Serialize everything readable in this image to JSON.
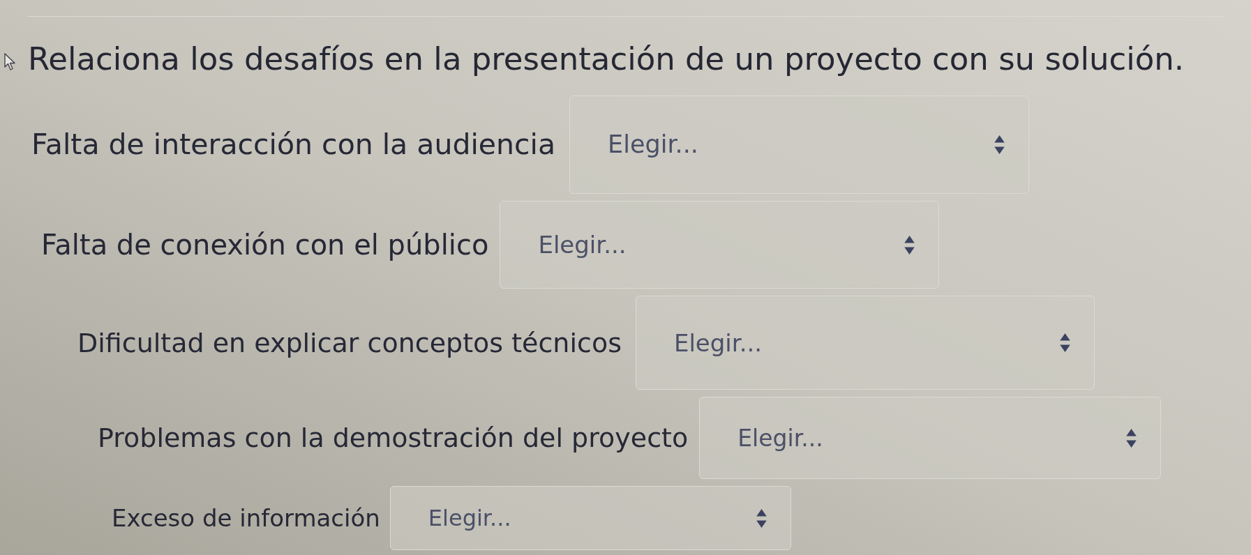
{
  "question": {
    "prompt": "Relaciona los desafíos en la presentación de un proyecto con su solución."
  },
  "pairs": [
    {
      "challenge": "Falta de interacción con la audiencia",
      "select": {
        "placeholder": "Elegir..."
      }
    },
    {
      "challenge": "Falta de conexión con el público",
      "select": {
        "placeholder": "Elegir..."
      }
    },
    {
      "challenge": "Dificultad en explicar conceptos técnicos",
      "select": {
        "placeholder": "Elegir..."
      }
    },
    {
      "challenge": "Problemas con la demostración del proyecto",
      "select": {
        "placeholder": "Elegir..."
      }
    },
    {
      "challenge": "Exceso de información",
      "select": {
        "placeholder": "Elegir..."
      }
    }
  ]
}
